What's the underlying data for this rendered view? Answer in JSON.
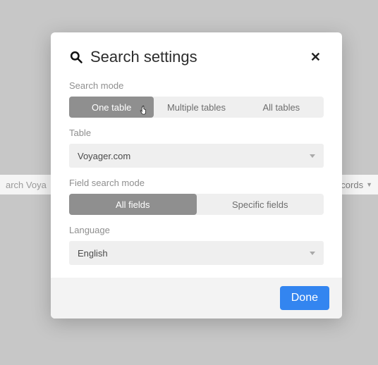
{
  "background": {
    "left_text": "arch Voya",
    "right_text": "cords"
  },
  "modal": {
    "title": "Search settings",
    "sections": {
      "search_mode": {
        "label": "Search mode",
        "options": [
          "One table",
          "Multiple tables",
          "All tables"
        ],
        "selected_index": 0
      },
      "table": {
        "label": "Table",
        "value": "Voyager.com"
      },
      "field_search_mode": {
        "label": "Field search mode",
        "options": [
          "All fields",
          "Specific fields"
        ],
        "selected_index": 0
      },
      "language": {
        "label": "Language",
        "value": "English"
      }
    },
    "done_label": "Done"
  }
}
